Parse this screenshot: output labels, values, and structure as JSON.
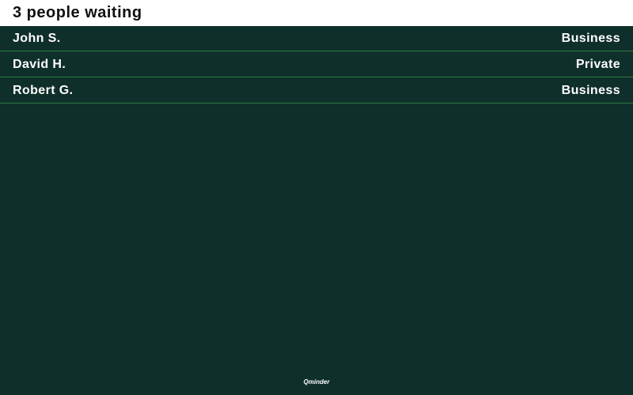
{
  "header": {
    "title": "3 people waiting"
  },
  "queue": [
    {
      "name": "John S.",
      "service": "Business"
    },
    {
      "name": "David H.",
      "service": "Private"
    },
    {
      "name": "Robert G.",
      "service": "Business"
    }
  ],
  "footer": {
    "logo_text": "Qminder"
  },
  "colors": {
    "background": "#0f2f2b",
    "header_background": "#ffffff",
    "divider": "#2d7a3f",
    "text": "#ffffff"
  }
}
